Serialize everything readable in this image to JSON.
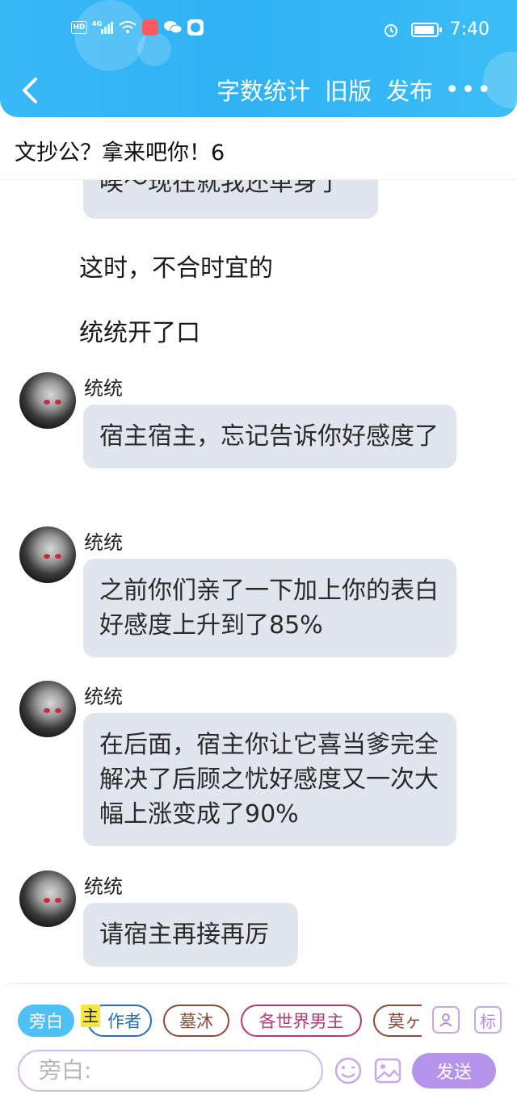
{
  "status_bar": {
    "time": "7:40",
    "network": "4G",
    "hd": "HD"
  },
  "nav": {
    "actions": [
      "字数统计",
      "旧版",
      "发布"
    ],
    "more": "•••"
  },
  "story_title": "文抄公？拿来吧你！6",
  "chat": {
    "partial_bubble": "唉～现在就我还单身了",
    "narrations": [
      "这时，不合时宜的",
      "统统开了口"
    ],
    "messages": [
      {
        "sender": "统统",
        "text": "宿主宿主，忘记告诉你好感度了"
      },
      {
        "sender": "统统",
        "text": "之前你们亲了一下加上你的表白好感度上升到了85%"
      },
      {
        "sender": "统统",
        "text": "在后面，宿主你让它喜当爹完全解决了后顾之忧好感度又一次大幅上涨变成了90%"
      },
      {
        "sender": "统统",
        "text": "请宿主再接再厉"
      }
    ]
  },
  "roles": [
    {
      "label": "旁白",
      "active": true,
      "color": "#4ec0f5"
    },
    {
      "label": "作者",
      "active": false,
      "color": "#2a6fb3",
      "tag": "主"
    },
    {
      "label": "墓沐",
      "active": false,
      "color": "#8a4b3a"
    },
    {
      "label": "各世界男主",
      "active": false,
      "color": "#b03a78"
    },
    {
      "label": "莫ヶ",
      "active": false,
      "color": "#8a4b3a"
    }
  ],
  "side_icons": {
    "character_icon": "person-card",
    "tag_icon": "标"
  },
  "input": {
    "placeholder": "旁白:",
    "send_label": "发送"
  },
  "colors": {
    "header": "#2fb2f5",
    "bubble": "#e1e6ee",
    "send": "#b794ec"
  }
}
